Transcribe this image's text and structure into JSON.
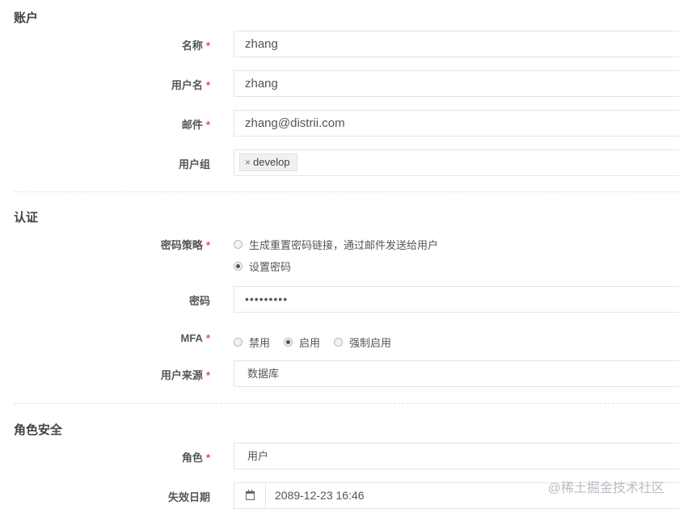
{
  "sections": {
    "account": "账户",
    "auth": "认证",
    "role_security": "角色安全"
  },
  "account": {
    "name_label": "名称",
    "name_value": "zhang",
    "username_label": "用户名",
    "username_value": "zhang",
    "email_label": "邮件",
    "email_value": "zhang@distrii.com",
    "group_label": "用户组",
    "group_tag_remove": "×",
    "group_tag": "develop"
  },
  "auth": {
    "password_policy_label": "密码策略",
    "policy_option_link": "生成重置密码链接，通过邮件发送给用户",
    "policy_option_set": "设置密码",
    "policy_selected": "设置密码",
    "password_label": "密码",
    "password_value": "•••••••••",
    "mfa_label": "MFA",
    "mfa_option_disable": "禁用",
    "mfa_option_enable": "启用",
    "mfa_option_force": "强制启用",
    "mfa_selected": "启用",
    "source_label": "用户来源",
    "source_value": "数据库"
  },
  "role_security": {
    "role_label": "角色",
    "role_value": "用户",
    "expire_label": "失效日期",
    "expire_value": "2089-12-23 16:46"
  },
  "required_mark": "*",
  "watermark": "@稀土掘金技术社区",
  "colors": {
    "required": "#e84a4a",
    "border": "#e4e4e4",
    "label": "#555555"
  }
}
